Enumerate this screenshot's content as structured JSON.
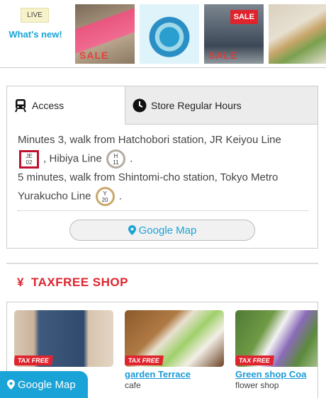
{
  "top": {
    "live_badge": "LIVE",
    "whats_new": "What's new!",
    "thumb_labels": [
      "SALE",
      "",
      "SALE",
      ""
    ],
    "sale_sign": "SALE"
  },
  "access": {
    "tabs": [
      {
        "label": "Access",
        "icon": "train-icon",
        "active": true
      },
      {
        "label": "Store Regular Hours",
        "icon": "clock-icon",
        "active": false
      }
    ],
    "route1_text": "Minutes 3, walk from Hatchobori station, JR Keiyou Line",
    "badge_je_line": "JE",
    "badge_je_num": "02",
    "route1_hibiya": ", Hibiya Line",
    "badge_h_line": "H",
    "badge_h_num": "11",
    "route1_end": ".",
    "route2_text": "5 minutes, walk from Shintomi-cho station, Tokyo Metro Yurakucho Line",
    "badge_y_line": "Y",
    "badge_y_num": "20",
    "route2_end": ".",
    "map_button": "Google Map"
  },
  "taxfree": {
    "heading_symbol": "¥",
    "heading": "TAXFREE SHOP",
    "ribbon": "TAX FREE",
    "shops": [
      {
        "name": "",
        "category": ""
      },
      {
        "name": "garden Terrace",
        "category": "cafe"
      },
      {
        "name": "Green shop Coa",
        "category": "flower shop"
      }
    ]
  },
  "floating": {
    "map_button": "Google Map"
  },
  "colors": {
    "accent": "#1aa3d6",
    "taxfree_red": "#e0242e",
    "je_red": "#c0122f"
  }
}
